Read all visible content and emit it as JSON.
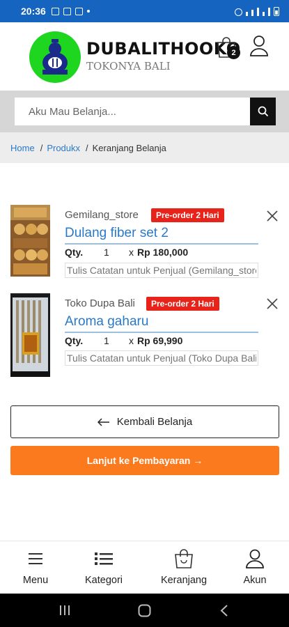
{
  "status_bar": {
    "time": "20:36"
  },
  "header": {
    "brand_name": "DUBALITHOOKO",
    "tagline": "TOKONYA BALI",
    "cart_count": "2",
    "logo_text": "DUBALITHOOKO"
  },
  "search": {
    "placeholder": "Aku Mau Belanja..."
  },
  "breadcrumb": {
    "items": [
      "Home",
      "Produkx",
      "Keranjang Belanja"
    ]
  },
  "cart": {
    "items": [
      {
        "store": "Gemilang_store",
        "badge": "Pre-order 2 Hari",
        "name": "Dulang fiber set 2",
        "qty_label": "Qty.",
        "qty": "1",
        "times": "x",
        "price": "Rp 180,000",
        "note_placeholder": "Tulis Catatan untuk Penjual (Gemilang_store)"
      },
      {
        "store": "Toko Dupa Bali",
        "badge": "Pre-order 2 Hari",
        "name": "Aroma gaharu",
        "qty_label": "Qty.",
        "qty": "1",
        "times": "x",
        "price": "Rp 69,990",
        "note_placeholder": "Tulis Catatan untuk Penjual (Toko Dupa Bali)"
      }
    ]
  },
  "actions": {
    "back_label": "Kembali Belanja",
    "pay_label": "Lanjut ke Pembayaran →"
  },
  "bottom_nav": {
    "items": [
      {
        "label": "Menu",
        "icon": "menu-icon"
      },
      {
        "label": "Kategori",
        "icon": "list-icon"
      },
      {
        "label": "Keranjang",
        "icon": "bag-icon"
      },
      {
        "label": "Akun",
        "icon": "user-icon"
      }
    ]
  },
  "colors": {
    "status_bar": "#1565c0",
    "logo_green": "#1ed620",
    "link_blue": "#2979c9",
    "badge_red": "#e8231a",
    "pay_orange": "#fb7a1d"
  }
}
